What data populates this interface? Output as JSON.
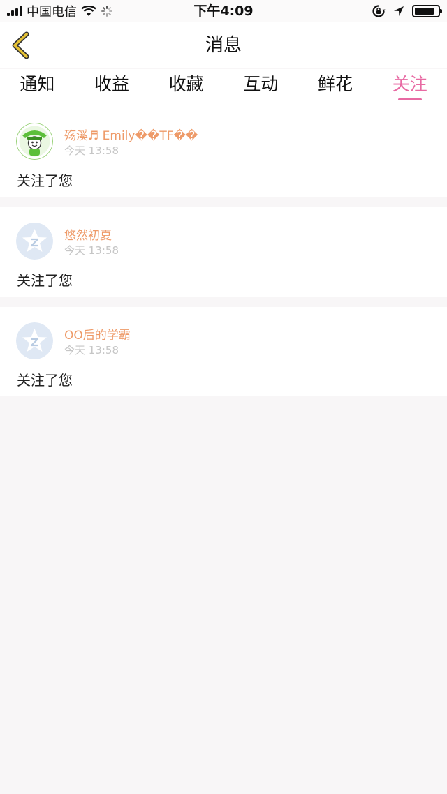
{
  "status_bar": {
    "carrier": "中国电信",
    "time": "下午4:09",
    "battery_level": 0.85
  },
  "nav": {
    "title": "消息"
  },
  "tabs": [
    {
      "label": "通知",
      "active": false
    },
    {
      "label": "收益",
      "active": false
    },
    {
      "label": "收藏",
      "active": false
    },
    {
      "label": "互动",
      "active": false
    },
    {
      "label": "鲜花",
      "active": false
    },
    {
      "label": "关注",
      "active": true
    }
  ],
  "items": [
    {
      "name": "殇溪♬ Emily��TF��",
      "time": "今天 13:58",
      "text": "关注了您",
      "avatar": "cartoon-avatar"
    },
    {
      "name": "悠然初夏",
      "time": "今天 13:58",
      "text": "关注了您",
      "avatar": "default-star-avatar"
    },
    {
      "name": "OO后的学霸",
      "time": "今天 13:58",
      "text": "关注了您",
      "avatar": "default-star-avatar"
    }
  ],
  "colors": {
    "accent": "#e86aa3",
    "username": "#ee9a68",
    "back_arrow": "#e6c234",
    "background": "#f8f6f7"
  }
}
